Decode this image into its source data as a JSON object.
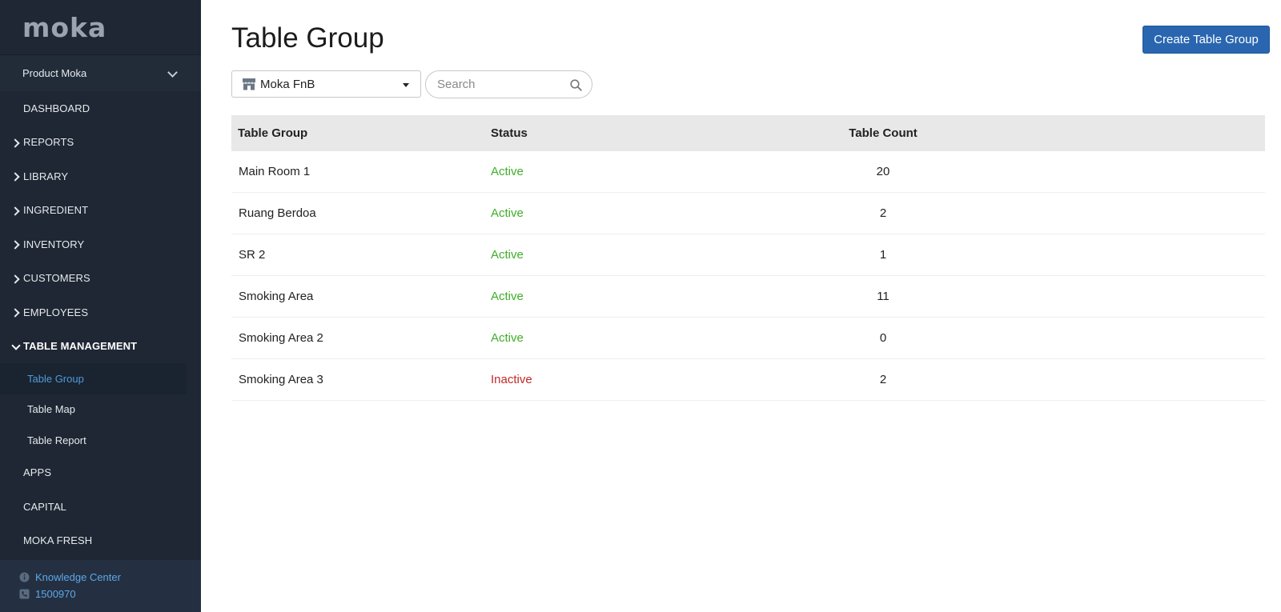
{
  "sidebar": {
    "logo": "moka",
    "product": "Product Moka",
    "items": [
      {
        "label": "DASHBOARD"
      },
      {
        "label": "REPORTS"
      },
      {
        "label": "LIBRARY"
      },
      {
        "label": "INGREDIENT"
      },
      {
        "label": "INVENTORY"
      },
      {
        "label": "CUSTOMERS"
      },
      {
        "label": "EMPLOYEES"
      },
      {
        "label": "TABLE MANAGEMENT"
      },
      {
        "label": "APPS"
      },
      {
        "label": "CAPITAL"
      },
      {
        "label": "MOKA FRESH"
      }
    ],
    "sub_items": [
      {
        "label": "Table Group",
        "active": true
      },
      {
        "label": "Table Map"
      },
      {
        "label": "Table Report"
      }
    ],
    "footer": {
      "knowledge_center": "Knowledge Center",
      "phone": "1500970"
    }
  },
  "main": {
    "title": "Table Group",
    "create_button": "Create Table Group",
    "outlet": "Moka FnB",
    "search_placeholder": "Search",
    "table": {
      "headers": [
        "Table Group",
        "Status",
        "Table Count"
      ],
      "rows": [
        {
          "name": "Main Room 1",
          "status": "Active",
          "count": "20"
        },
        {
          "name": "Ruang Berdoa",
          "status": "Active",
          "count": "2"
        },
        {
          "name": "SR 2",
          "status": "Active",
          "count": "1"
        },
        {
          "name": "Smoking Area",
          "status": "Active",
          "count": "11"
        },
        {
          "name": "Smoking Area 2",
          "status": "Active",
          "count": "0"
        },
        {
          "name": "Smoking Area 3",
          "status": "Inactive",
          "count": "2"
        }
      ]
    }
  },
  "colors": {
    "sidebar_bg": "#1e2733",
    "active_link": "#4f9bd9",
    "primary_button": "#2a66b0",
    "status_active": "#3fae2a",
    "status_inactive": "#c02a2a"
  }
}
